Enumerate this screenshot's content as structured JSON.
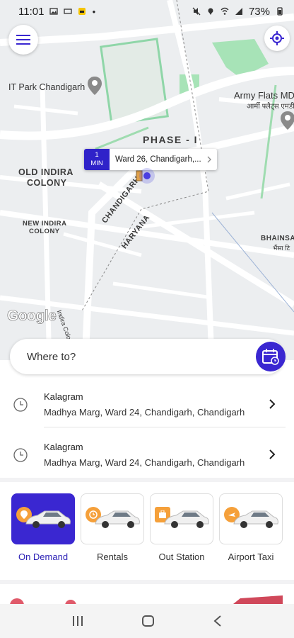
{
  "status_bar": {
    "time": "11:01",
    "battery": "73%"
  },
  "map": {
    "labels": {
      "it_park": "IT Park Chandigarh",
      "army_flats": "Army Flats MD",
      "army_flats_hindi": "आर्मी फ्लैट्स एमडी",
      "phase": "PHASE - I",
      "old_indira_1": "OLD INDIRA",
      "old_indira_2": "COLONY",
      "new_indira_1": "NEW INDIRA",
      "new_indira_2": "COLONY",
      "chd_1": "CHANDIGARH",
      "chd_2": "HARYANA",
      "bhainsa": "BHAINSA T",
      "bhainsa_hindi": "भैंसा टि",
      "indira_colony_road": "Indira Colony"
    },
    "eta": {
      "value": "1",
      "unit": "MIN",
      "address": "Ward 26, Chandigarh,..."
    },
    "google_logo": "Google"
  },
  "search": {
    "placeholder": "Where to?"
  },
  "recent_places": [
    {
      "title": "Kalagram",
      "address": "Madhya Marg, Ward 24, Chandigarh, Chandigarh"
    },
    {
      "title": "Kalagram",
      "address": "Madhya Marg, Ward 24, Chandigarh, Chandigarh"
    }
  ],
  "services": [
    {
      "label": "On Demand",
      "icon": "location-pin-icon"
    },
    {
      "label": "Rentals",
      "icon": "clock-icon"
    },
    {
      "label": "Out Station",
      "icon": "luggage-icon"
    },
    {
      "label": "Airport Taxi",
      "icon": "plane-icon"
    }
  ],
  "colors": {
    "accent": "#3a27d1",
    "badge": "#f5a03a"
  }
}
